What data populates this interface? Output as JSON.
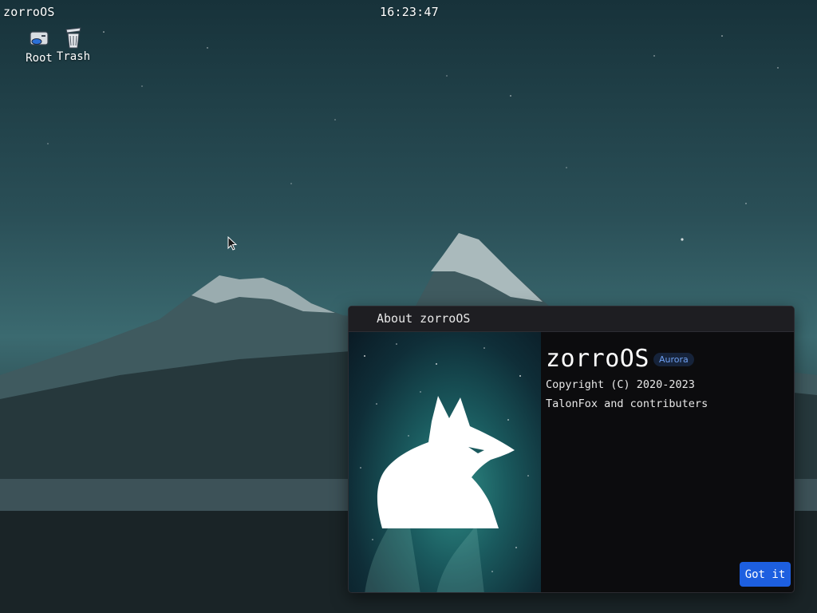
{
  "topbar": {
    "app_name": "zorroOS",
    "clock": "16:23:47"
  },
  "desktop": {
    "icons": [
      {
        "label": "Root",
        "icon": "drive-icon"
      },
      {
        "label": "Trash",
        "icon": "trash-icon"
      }
    ]
  },
  "dialog": {
    "title": "About zorroOS",
    "product_name": "zorroOS",
    "version_badge": "Aurora",
    "copyright": "Copyright (C) 2020-2023",
    "authors": "TalonFox and contributers",
    "button_label": "Got it",
    "logo_icon": "fox-icon"
  },
  "colors": {
    "accent": "#1d5fe0",
    "badge_text": "#6fa0f2",
    "dialog_bg": "#0c0c0e",
    "titlebar_bg": "#1e1e22"
  }
}
